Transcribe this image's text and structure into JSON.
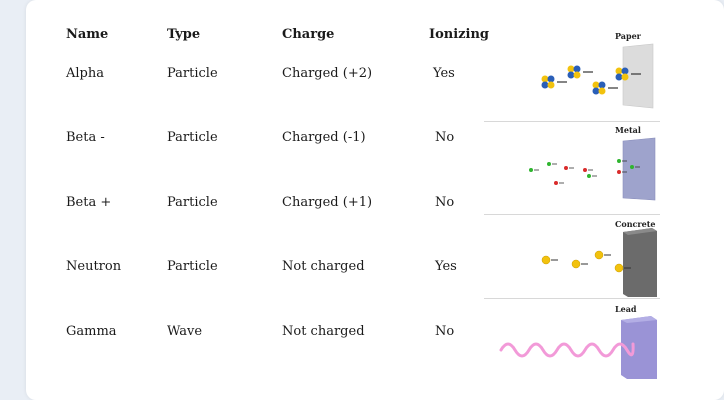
{
  "table": {
    "headers": [
      "Name",
      "Type",
      "Charge",
      "Ionizing"
    ],
    "rows": [
      {
        "name": "Alpha",
        "type": "Particle",
        "charge": "Charged (+2)",
        "ionizing": "Yes"
      },
      {
        "name": "Beta -",
        "type": "Particle",
        "charge": "Charged (-1)",
        "ionizing": "No"
      },
      {
        "name": "Beta +",
        "type": "Particle",
        "charge": "Charged (+1)",
        "ionizing": "No"
      },
      {
        "name": "Neutron",
        "type": "Particle",
        "charge": "Not charged",
        "ionizing": "Yes"
      },
      {
        "name": "Gamma",
        "type": "Wave",
        "charge": "Not charged",
        "ionizing": "No"
      }
    ]
  },
  "illustration": {
    "barriers": [
      "Paper",
      "Metal",
      "Concrete",
      "Lead"
    ],
    "colors": {
      "paper": "#dcdcdc",
      "metal": "#9ea3cc",
      "concrete": "#6b6b6b",
      "lead": "#9a93d6",
      "gamma_wave": "#f29ad8",
      "beta_minus": "#d92b2b",
      "beta_plus": "#2fb52f",
      "nucleon_yellow": "#f2c20e",
      "nucleon_blue": "#2a5fb8"
    }
  }
}
